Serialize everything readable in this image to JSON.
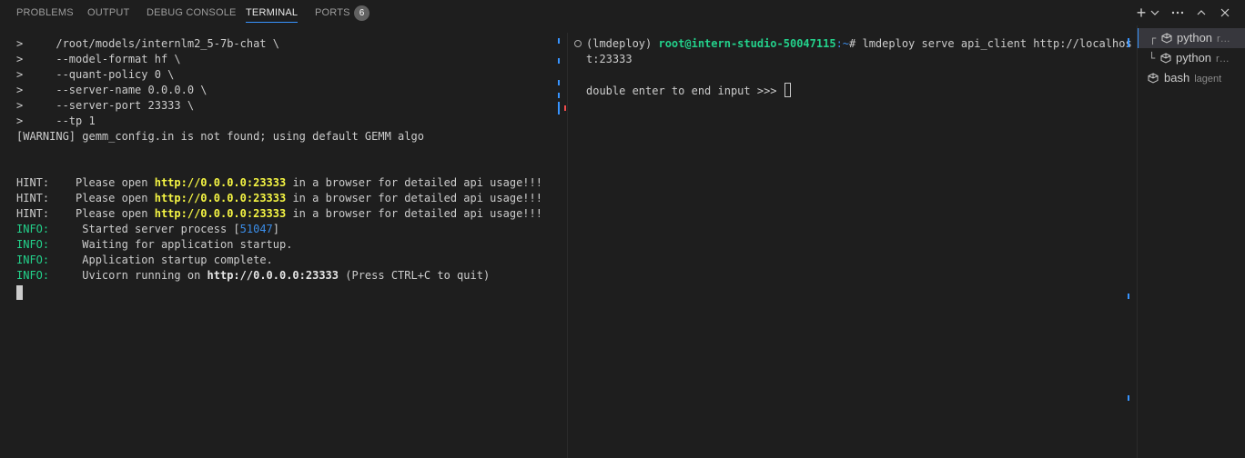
{
  "tabs": [
    {
      "label": "PROBLEMS"
    },
    {
      "label": "OUTPUT"
    },
    {
      "label": "DEBUG CONSOLE"
    },
    {
      "label": "TERMINAL"
    },
    {
      "label": "PORTS"
    }
  ],
  "ports_count": "6",
  "toolbar": {
    "new_terminal_icon": "plus-icon",
    "dropdown_icon": "chevron-down-icon",
    "more_icon": "ellipsis-icon",
    "maximize_icon": "chevron-up-icon",
    "close_icon": "close-icon"
  },
  "left_terminal": {
    "cmd_lines": [
      ">     /root/models/internlm2_5-7b-chat \\",
      ">     --model-format hf \\",
      ">     --quant-policy 0 \\",
      ">     --server-name 0.0.0.0 \\",
      ">     --server-port 23333 \\",
      ">     --tp 1"
    ],
    "warning": "[WARNING] gemm_config.in is not found; using default GEMM algo",
    "hint_prefix": "HINT:    Please open ",
    "hint_url": "http://0.0.0.0:23333",
    "hint_suffix": " in a browser for detailed api usage!!!",
    "info_label": "INFO:",
    "info_started_pre": "     Started server process [",
    "info_pid": "51047",
    "info_started_post": "]",
    "info_waiting": "     Waiting for application startup.",
    "info_complete": "     Application startup complete.",
    "info_uvicorn_pre": "     Uvicorn running on ",
    "info_uvicorn_url": "http://0.0.0.0:23333",
    "info_uvicorn_post": " (Press CTRL+C to quit)"
  },
  "right_terminal": {
    "env": "(lmdeploy) ",
    "user_host": "root@intern-studio-50047115",
    "path": ":~",
    "prompt_symbol": "# ",
    "command": "lmdeploy serve api_client http://localhos",
    "command_wrap": "t:23333",
    "input_prompt": "double enter to end input >>> "
  },
  "sidebar": {
    "items": [
      {
        "name": "python",
        "desc": "r…",
        "tree": "┌"
      },
      {
        "name": "python",
        "desc": "r…",
        "tree": "└"
      },
      {
        "name": "bash",
        "desc": "lagent",
        "tree": ""
      }
    ]
  },
  "colors": {
    "accent": "#3794ff",
    "info_green": "#23d18b",
    "url_yellow": "#f5f543",
    "pid_blue": "#3b8eea",
    "background": "#1e1e1e"
  }
}
